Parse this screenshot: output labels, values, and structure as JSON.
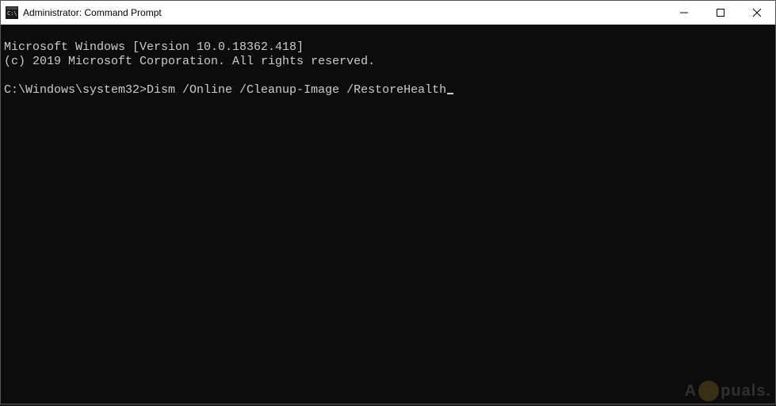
{
  "window": {
    "title": "Administrator: Command Prompt"
  },
  "terminal": {
    "line1": "Microsoft Windows [Version 10.0.18362.418]",
    "line2": "(c) 2019 Microsoft Corporation. All rights reserved.",
    "blank": "",
    "prompt": "C:\\Windows\\system32>",
    "command": "Dism /Online /Cleanup-Image /RestoreHealth"
  },
  "watermark": {
    "text_left": "A",
    "text_right": "puals."
  }
}
